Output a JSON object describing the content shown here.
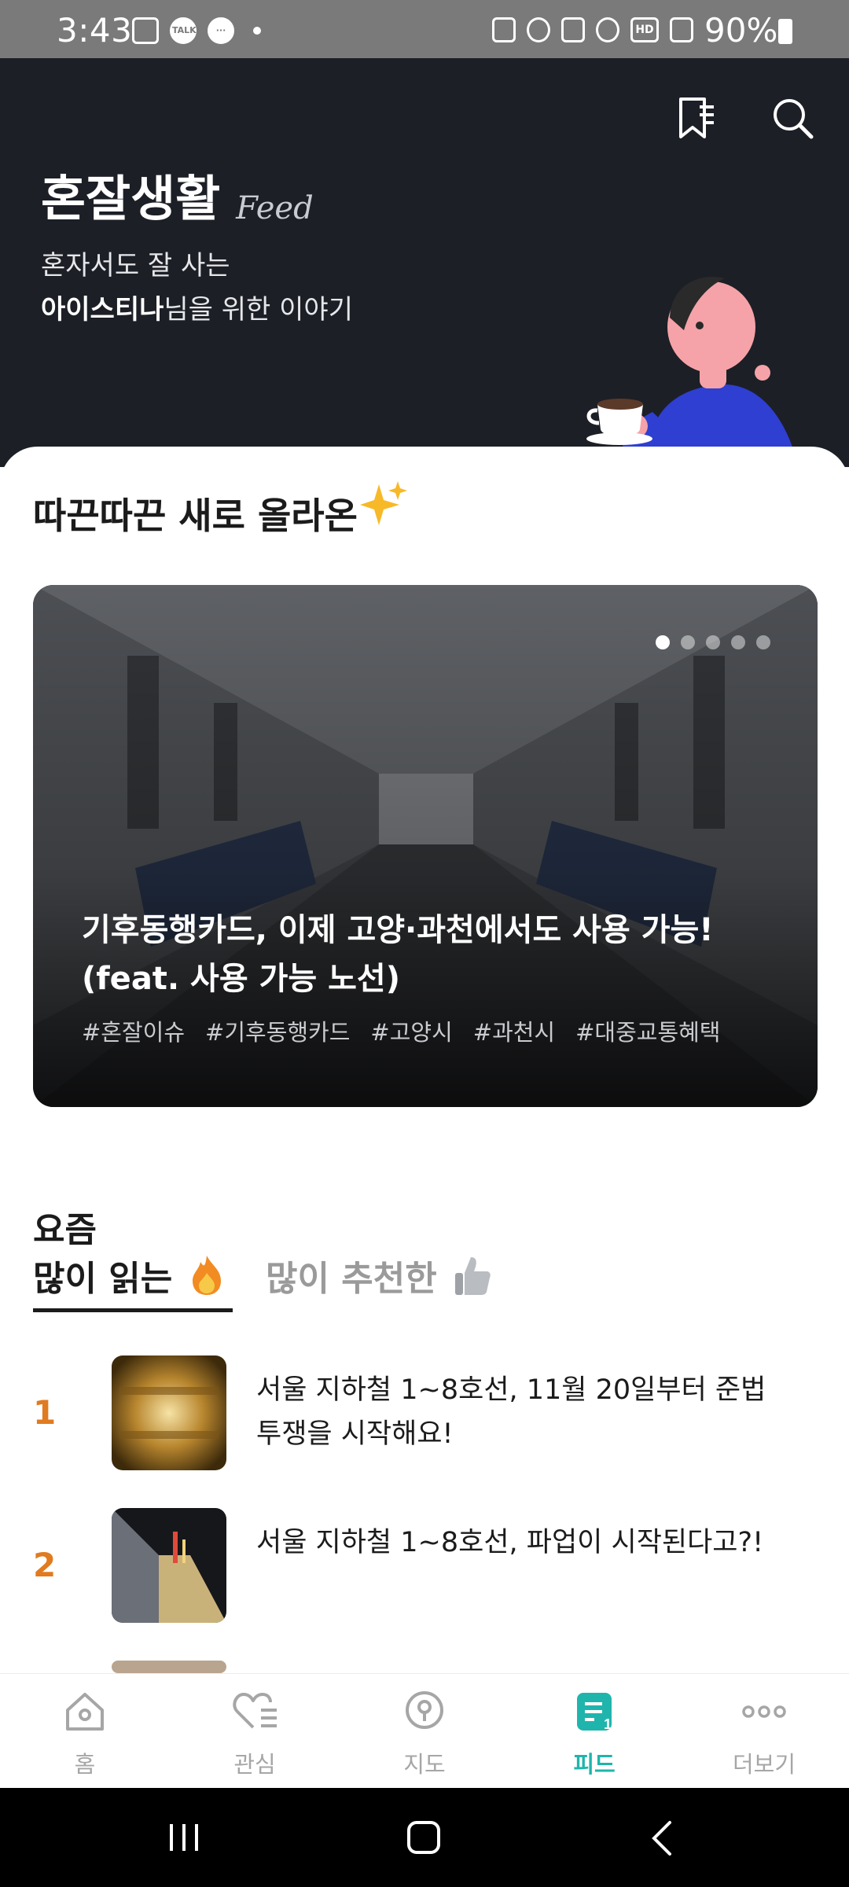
{
  "status_bar": {
    "time": "3:43",
    "battery": "90%",
    "left_icons": [
      "image-icon",
      "talk-icon",
      "message-icon",
      "notification-dot-icon"
    ],
    "right_icons": [
      "battery-saver-icon",
      "alarm-icon",
      "mute-icon",
      "wifi-icon",
      "hd-icon",
      "signal-icon"
    ],
    "talk_badge": "TALK",
    "hd_badge": "HD"
  },
  "header": {
    "title": "혼잘생활",
    "subtitle": "Feed",
    "desc_line1": "혼자서도 잘 사는",
    "user_name": "아이스티나",
    "desc_line2_suffix": "님을 위한 이야기",
    "bookmark_icon": "bookmark-list-icon",
    "search_icon": "search-icon"
  },
  "new_section": {
    "title": "따끈따끈 새로 올라온",
    "emoji_icon": "sparkles-icon",
    "card": {
      "headline": "기후동행카드, 이제 고양·과천에서도 사용 가능! (feat. 사용 가능 노선)",
      "tags": [
        "#혼잘이슈",
        "#기후동행카드",
        "#고양시",
        "#과천시",
        "#대중교통혜택"
      ],
      "page_count": 5,
      "active_page": 1
    }
  },
  "popular": {
    "label": "요즘",
    "tabs": [
      {
        "label": "많이 읽는",
        "icon": "fire-icon",
        "active": true
      },
      {
        "label": "많이 추천한",
        "icon": "thumbs-up-icon",
        "active": false
      }
    ],
    "items": [
      {
        "rank": "1",
        "title": "서울 지하철 1~8호선, 11월 20일부터 준법투쟁을 시작해요!"
      },
      {
        "rank": "2",
        "title": "서울 지하철 1~8호선, 파업이 시작된다고?!"
      }
    ]
  },
  "bottom_nav": [
    {
      "label": "홈",
      "icon": "home-icon",
      "active": false
    },
    {
      "label": "관심",
      "icon": "heart-list-icon",
      "active": false
    },
    {
      "label": "지도",
      "icon": "map-pin-icon",
      "active": false
    },
    {
      "label": "피드",
      "icon": "feed-icon",
      "active": true,
      "badge": "1"
    },
    {
      "label": "더보기",
      "icon": "more-icon",
      "active": false
    }
  ],
  "colors": {
    "header_bg": "#1c1f26",
    "accent_teal": "#1fb5ac",
    "rank_orange": "#e07b1f"
  }
}
